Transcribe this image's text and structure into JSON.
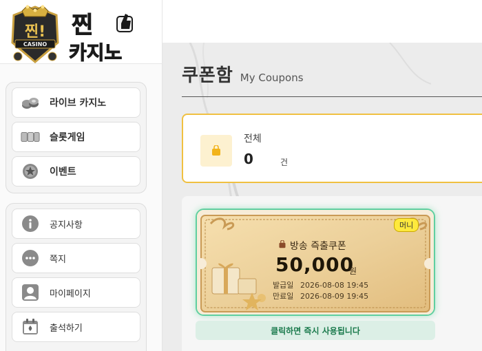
{
  "brand": {
    "badge_text": "찐!",
    "badge_sub": "CASINO",
    "title_line1": "찐",
    "title_line2": "카지노"
  },
  "sidebar": {
    "primary": [
      {
        "label": "라이브 카지노",
        "icon": "chips-icon"
      },
      {
        "label": "슬롯게임",
        "icon": "slot-reels-icon"
      },
      {
        "label": "이벤트",
        "icon": "star-badge-icon"
      }
    ],
    "secondary": [
      {
        "label": "공지사항",
        "icon": "info-icon"
      },
      {
        "label": "쪽지",
        "icon": "chat-bubble-icon"
      },
      {
        "label": "마이페이지",
        "icon": "user-icon"
      },
      {
        "label": "출석하기",
        "icon": "calendar-icon"
      }
    ]
  },
  "page": {
    "title": "쿠폰함",
    "subtitle": "My Coupons"
  },
  "summary": {
    "label": "전체",
    "count": "0",
    "unit": "건"
  },
  "coupon": {
    "badge": "머니",
    "name": "방송 즉출쿠폰",
    "amount": "50,000",
    "amount_unit": "원",
    "issued_label": "발급일",
    "issued_date": "2026-08-08 19:45",
    "expire_label": "만료일",
    "expire_date": "2026-08-09 19:45",
    "action_text": "클릭하면 즉시 사용됩니다"
  },
  "colors": {
    "accent": "#f0c040",
    "coupon_border": "#5fcfa0",
    "action_text": "#1a7a4c",
    "badge": "#ffe93d"
  }
}
